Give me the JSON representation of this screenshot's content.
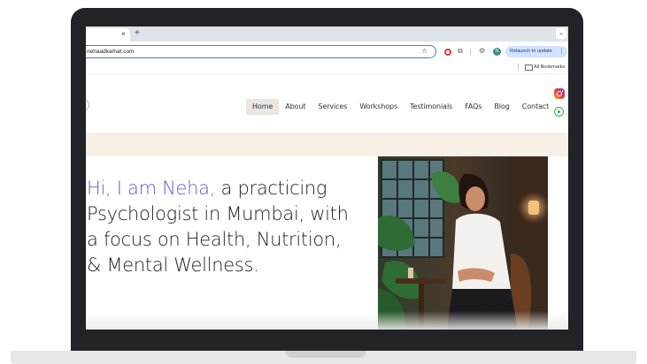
{
  "browser": {
    "tab_close": "×",
    "new_tab": "+",
    "tab_menu": "⌄",
    "url": "nehaadkamat.com",
    "star": "☆",
    "profile_initial": "N",
    "relaunch_label": "Relaunch to update",
    "menu_dots": "⋮",
    "bookmarks_label": "All Bookmarks"
  },
  "nav": {
    "items": [
      "Home",
      "About",
      "Services",
      "Workshops",
      "Testimonials",
      "FAQs",
      "Blog",
      "Contact"
    ],
    "active": "Home"
  },
  "hero": {
    "accent": "Hi, I am Neha,",
    "rest": " a practicing Psychologist in Mumbai, with a focus on Health, Nutrition, & Mental Wellness."
  },
  "social": {
    "icons": [
      "instagram-icon",
      "whatsapp-icon"
    ]
  },
  "colors": {
    "accent": "#6a5ad8",
    "band": "#f8efe7",
    "nav_active_bg": "#ebe6e1",
    "whatsapp": "#2fb24c",
    "relaunch_bg": "#d3e3fd"
  }
}
